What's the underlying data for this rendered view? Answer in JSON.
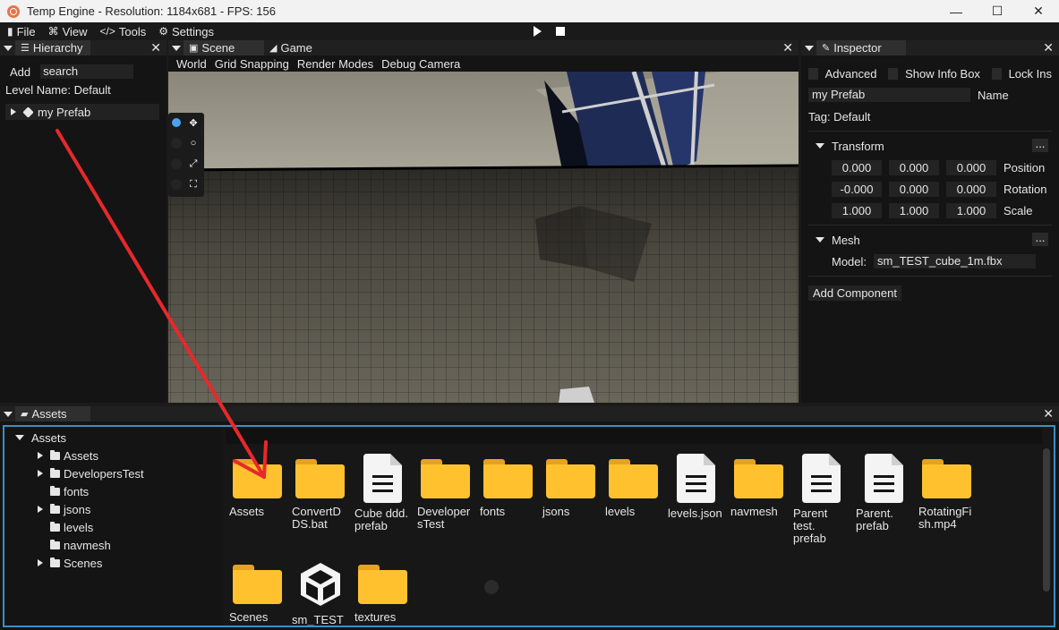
{
  "window": {
    "title": "Temp Engine - Resolution: 1184x681 - FPS: 156",
    "minimize": "—",
    "maximize": "☐",
    "close": "✕"
  },
  "menu": {
    "file": "File",
    "view": "View",
    "tools": "Tools",
    "settings": "Settings"
  },
  "hierarchy": {
    "tab": "Hierarchy",
    "add": "Add",
    "search": "search",
    "level_name": "Level Name: Default",
    "items": [
      {
        "label": "my Prefab"
      }
    ]
  },
  "scene": {
    "tab_scene": "Scene",
    "tab_game": "Game",
    "menu": [
      "World",
      "Grid Snapping",
      "Render Modes",
      "Debug Camera"
    ]
  },
  "inspector": {
    "tab": "Inspector",
    "advanced": "Advanced",
    "show_info_box": "Show Info Box",
    "lock": "Lock Ins",
    "name_value": "my Prefab",
    "name_label": "Name",
    "tag": "Tag: Default",
    "transform": {
      "title": "Transform",
      "more": "...",
      "position": {
        "label": "Position",
        "x": "0.000",
        "y": "0.000",
        "z": "0.000"
      },
      "rotation": {
        "label": "Rotation",
        "x": "-0.000",
        "y": "0.000",
        "z": "0.000"
      },
      "scale": {
        "label": "Scale",
        "x": "1.000",
        "y": "1.000",
        "z": "1.000"
      }
    },
    "mesh": {
      "title": "Mesh",
      "more": "...",
      "model_label": "Model:",
      "model_value": "sm_TEST_cube_1m.fbx"
    },
    "add_component": "Add Component"
  },
  "assets": {
    "tab": "Assets",
    "tree": [
      {
        "label": "Assets",
        "expanded": true
      },
      {
        "label": "Assets"
      },
      {
        "label": "DevelopersTest"
      },
      {
        "label": "fonts"
      },
      {
        "label": "jsons"
      },
      {
        "label": "levels"
      },
      {
        "label": "navmesh"
      },
      {
        "label": "Scenes"
      }
    ],
    "grid": [
      {
        "label": "Assets",
        "icon": "folder-icon"
      },
      {
        "label": "ConvertD\nDS.bat",
        "icon": "folder-icon"
      },
      {
        "label": "Cube ddd.\nprefab",
        "icon": "document-icon"
      },
      {
        "label": "Developer\nsTest",
        "icon": "folder-icon"
      },
      {
        "label": "fonts",
        "icon": "folder-icon"
      },
      {
        "label": "jsons",
        "icon": "folder-icon"
      },
      {
        "label": "levels",
        "icon": "folder-icon"
      },
      {
        "label": "levels.json",
        "icon": "document-icon"
      },
      {
        "label": "navmesh",
        "icon": "folder-icon"
      },
      {
        "label": "Parent\ntest.\nprefab",
        "icon": "document-icon"
      },
      {
        "label": "Parent.\nprefab",
        "icon": "document-icon"
      },
      {
        "label": "RotatingFi\nsh.mp4",
        "icon": "folder-icon"
      },
      {
        "label": "Scenes",
        "icon": "folder-icon"
      },
      {
        "label": "sm_TEST",
        "icon": "cube-icon"
      },
      {
        "label": "textures",
        "icon": "folder-icon"
      }
    ]
  },
  "colors": {
    "accent_blue": "#3d8ec2",
    "folder_yellow": "#ffc22e",
    "annotation_red": "#e8282b"
  }
}
